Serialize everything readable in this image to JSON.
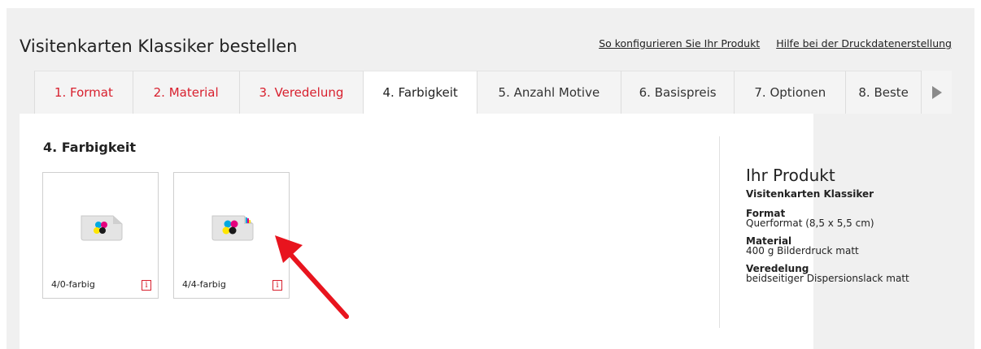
{
  "header": {
    "title": "Visitenkarten Klassiker bestellen",
    "links": [
      "So konfigurieren Sie Ihr Produkt",
      "Hilfe bei der Druckdatenerstellung"
    ]
  },
  "tabs": [
    {
      "label": "1. Format"
    },
    {
      "label": "2. Material"
    },
    {
      "label": "3. Veredelung"
    },
    {
      "label": "4. Farbigkeit"
    },
    {
      "label": "5. Anzahl Motive"
    },
    {
      "label": "6. Basispreis"
    },
    {
      "label": "7. Optionen"
    },
    {
      "label": "8. Beste"
    }
  ],
  "section": {
    "title": "4. Farbigkeit"
  },
  "options": [
    {
      "label": "4/0-farbig",
      "info": "i"
    },
    {
      "label": "4/4-farbig",
      "info": "i"
    }
  ],
  "summary": {
    "title": "Ihr Produkt",
    "product": "Visitenkarten Klassiker",
    "items": [
      {
        "label": "Format",
        "value": "Querformat (8,5 x 5,5 cm)"
      },
      {
        "label": "Material",
        "value": "400 g Bilderdruck matt"
      },
      {
        "label": "Veredelung",
        "value": "beidseitiger Dispersionslack matt"
      }
    ]
  },
  "colors": {
    "accent": "#d8202e",
    "annotation_arrow": "#e8141e"
  },
  "icons": {
    "tab_next": "triangle-right-icon",
    "option_image": "cmyk-card-icon",
    "info": "info-icon"
  }
}
